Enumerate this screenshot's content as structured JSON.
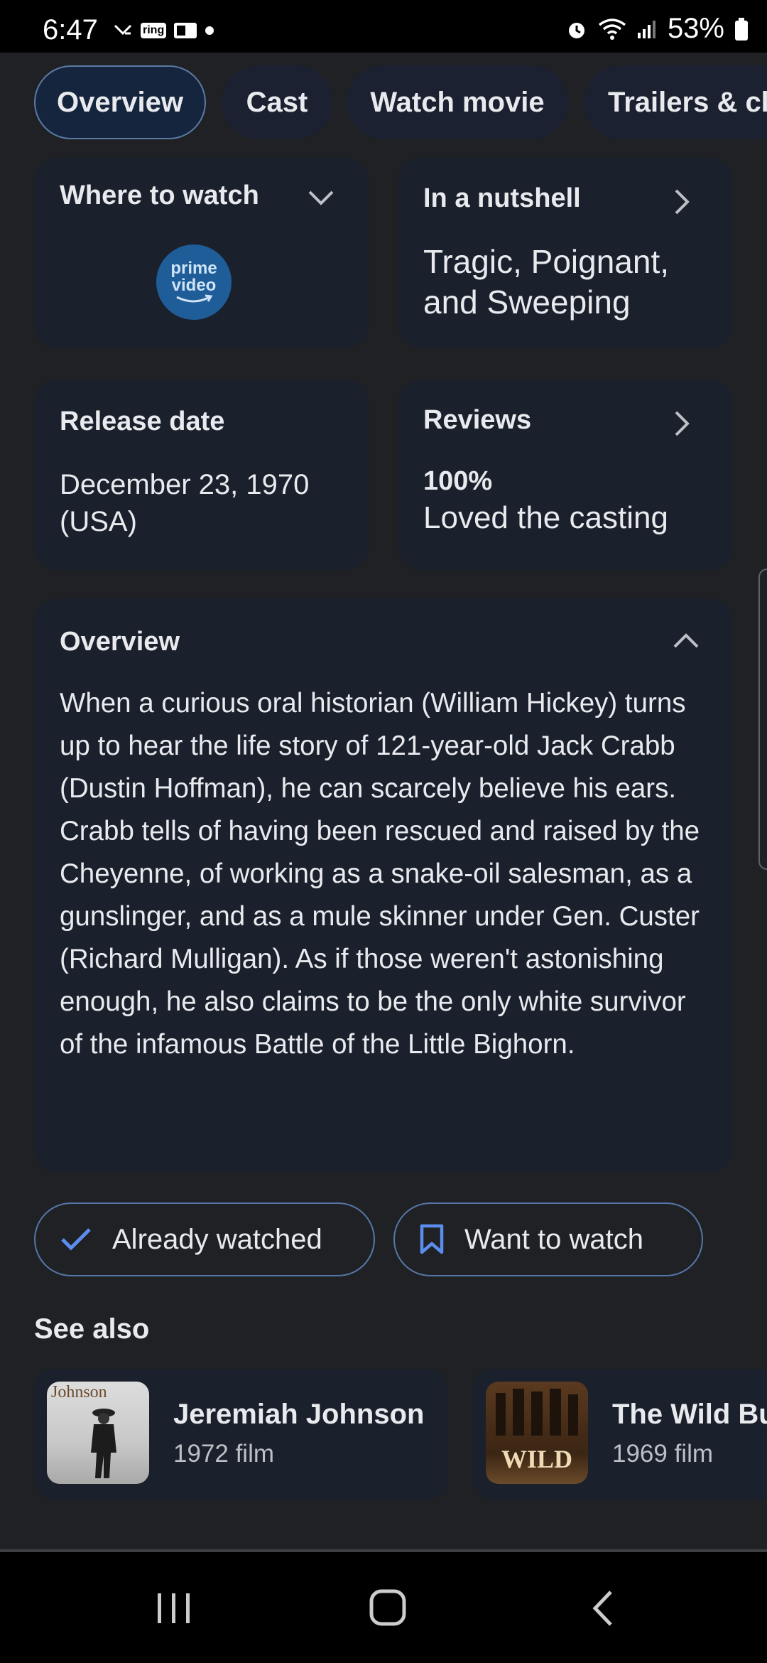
{
  "status_bar": {
    "time": "6:47",
    "notif_badge_1": "ring",
    "battery": "53%"
  },
  "tabs": [
    {
      "label": "Overview",
      "active": true
    },
    {
      "label": "Cast"
    },
    {
      "label": "Watch movie"
    },
    {
      "label": "Trailers & cli"
    }
  ],
  "where_to_watch": {
    "title": "Where to watch",
    "provider_logo_text_1": "prime",
    "provider_logo_text_2": "video"
  },
  "nutshell": {
    "title": "In a nutshell",
    "text": "Tragic, Poignant, and Sweeping"
  },
  "release": {
    "title": "Release date",
    "date": "December 23, 1970",
    "region": "(USA)"
  },
  "reviews": {
    "title": "Reviews",
    "percent": "100%",
    "subtitle": "Loved the casting"
  },
  "overview": {
    "title": "Overview",
    "text": "When a curious oral historian (William Hickey) turns up to hear the life story of 121-year-old Jack Crabb (Dustin Hoffman), he can scarcely believe his ears. Crabb tells of having been rescued and raised by the Cheyenne, of working as a snake-oil salesman, as a gunslinger, and as a mule skinner under Gen. Custer (Richard Mulligan). As if those weren't astonishing enough, he also claims to be the only white survivor of the infamous Battle of the Little Bighorn."
  },
  "actions": {
    "watched_label": "Already watched",
    "want_label": "Want to watch"
  },
  "see_also": {
    "title": "See also",
    "items": [
      {
        "title": "Jeremiah Johnson",
        "subtitle": "1972 film",
        "poster_text": "Johnson"
      },
      {
        "title": "The Wild Bu",
        "subtitle": "1969 film",
        "poster_text": "WILD"
      }
    ]
  },
  "colors": {
    "background": "#202124",
    "card": "#1a202c",
    "accent_blue": "#5b8def",
    "outline": "#5577a8"
  }
}
